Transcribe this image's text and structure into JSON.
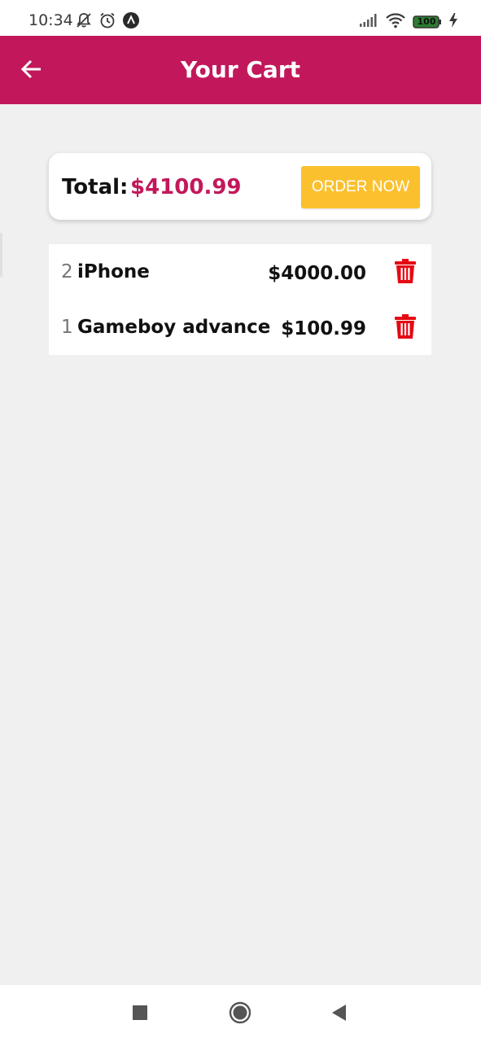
{
  "status_bar": {
    "time": "10:34",
    "battery_level": "100",
    "left_icons": [
      "notifications-off-icon",
      "alarm-icon",
      "app-notification-icon"
    ],
    "right_icons": [
      "signal-icon",
      "wifi-icon",
      "battery-icon",
      "charging-icon"
    ]
  },
  "app_bar": {
    "title": "Your Cart",
    "back_icon": "arrow-left-icon",
    "color": "#c2185b"
  },
  "summary": {
    "total_label": "Total:",
    "total_amount": "$4100.99",
    "order_button_label": "ORDER NOW",
    "accent_color": "#c2185b",
    "button_color": "#fbc02d"
  },
  "cart": {
    "items": [
      {
        "quantity": "2",
        "name": "iPhone",
        "price": "$4000.00",
        "delete_icon": "trash-icon"
      },
      {
        "quantity": "1",
        "name": "Gameboy advance",
        "price": "$100.99",
        "delete_icon": "trash-icon"
      }
    ],
    "delete_color": "#e50914"
  },
  "nav_bar": {
    "buttons": [
      "recents-square-icon",
      "home-circle-icon",
      "back-triangle-icon"
    ]
  }
}
